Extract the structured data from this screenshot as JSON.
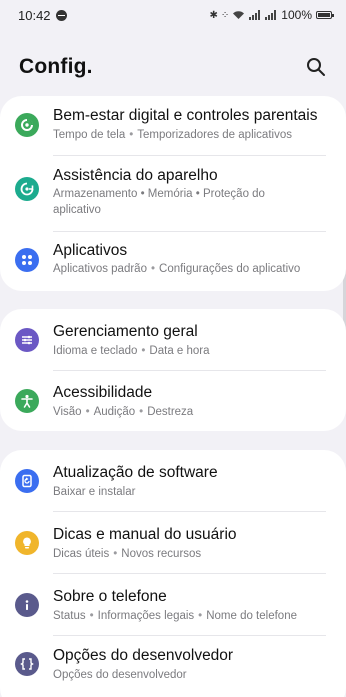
{
  "status_bar": {
    "time": "10:42",
    "battery": "100%",
    "icons": [
      "do-not-disturb-icon",
      "bluetooth-icon",
      "vibrate-icon",
      "wifi-icon",
      "signal-icon",
      "signal-icon",
      "battery-icon"
    ]
  },
  "header": {
    "title": "Config.",
    "search_icon": "search-icon"
  },
  "colors": {
    "green": "#3ba95b",
    "teal": "#1cab8e",
    "blue": "#3b6ef0",
    "purple": "#6b58c4",
    "yellow": "#f0b52b",
    "slate": "#5a5a8c"
  },
  "items": [
    {
      "title": "Bem-estar digital e controles parentais",
      "subs": [
        "Tempo de tela",
        "Temporizadores de aplicativos"
      ],
      "icon": "digital-wellbeing-icon"
    },
    {
      "title": "Assistência do aparelho",
      "sub_text": "Armazenamento • Memória • Proteção do aplicativo",
      "icon": "device-care-icon"
    },
    {
      "title": "Aplicativos",
      "subs": [
        "Aplicativos padrão",
        "Configurações do aplicativo"
      ],
      "icon": "apps-icon"
    },
    {
      "title": "Gerenciamento geral",
      "subs": [
        "Idioma e teclado",
        "Data e hora"
      ],
      "icon": "general-management-icon"
    },
    {
      "title": "Acessibilidade",
      "subs": [
        "Visão",
        "Audição",
        "Destreza"
      ],
      "icon": "accessibility-icon"
    },
    {
      "title": "Atualização de software",
      "subs": [
        "Baixar e instalar"
      ],
      "icon": "software-update-icon"
    },
    {
      "title": "Dicas e manual do usuário",
      "subs": [
        "Dicas úteis",
        "Novos recursos"
      ],
      "icon": "tips-icon"
    },
    {
      "title": "Sobre o telefone",
      "subs": [
        "Status",
        "Informações legais",
        "Nome do telefone"
      ],
      "icon": "about-phone-icon"
    },
    {
      "title": "Opções do desenvolvedor",
      "subs": [
        "Opções do desenvolvedor"
      ],
      "icon": "developer-options-icon"
    }
  ]
}
